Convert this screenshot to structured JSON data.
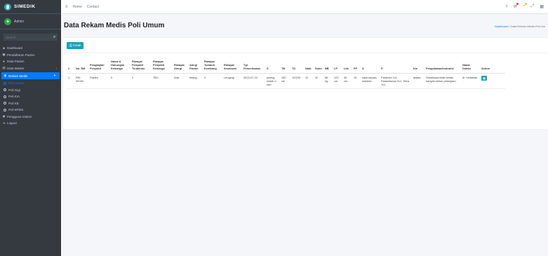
{
  "brand": {
    "name": "SIMEDIK"
  },
  "user": {
    "name": "Admin"
  },
  "search": {
    "placeholder": "Search"
  },
  "menu": [
    {
      "label": "Dashboard",
      "icon": "dashboard-icon"
    },
    {
      "label": "Pendaftaran Pasien",
      "icon": "register-icon"
    },
    {
      "label": "Data Pasien",
      "icon": "patients-icon"
    },
    {
      "label": "Data Master",
      "icon": "database-icon"
    },
    {
      "label": "Rekam Medik",
      "icon": "book-icon"
    },
    {
      "label": "Poli Umum"
    },
    {
      "label": "Poli Gigi"
    },
    {
      "label": "Poli KIA"
    },
    {
      "label": "Poli KB"
    },
    {
      "label": "Poli MTBS"
    },
    {
      "label": "Pengguna Sistem",
      "icon": "user-icon"
    },
    {
      "label": "Logout",
      "icon": "logout-icon"
    }
  ],
  "topbar": {
    "home": "Home",
    "contact": "Contact"
  },
  "page": {
    "title": "Data Rekam Medis Poli Umum",
    "breadcrumb_home": "Dashboard",
    "breadcrumb_current": "Data Rekam Medis Poli Um"
  },
  "buttons": {
    "print": "Cetak"
  },
  "table": {
    "headers": [
      "#",
      "No. RM",
      "Pengkajian Penyakit",
      "Nama & Hubungan Keluarga",
      "Riwayat Penyakit Terdahulu",
      "Riwayat Penyakit Keluarga",
      "Riwayat Alergi",
      "Alergi Pasien",
      "Riwayat Tumbuh Kembang",
      "Riwayat Imunisasi",
      "Tgl Pemeriksaan",
      "S",
      "TB",
      "TD",
      "Nadi",
      "Suhu",
      "BB",
      "LP",
      "Lila",
      "PF",
      "A",
      "P",
      "Kie",
      "Pengobatan/Instruksi",
      "Nama Dokter",
      "Action"
    ],
    "rows": [
      [
        "1.",
        "RM-00045",
        "Pasien",
        "0",
        "0",
        "TBC",
        "Ada",
        "bitang",
        "0",
        "Lengkap",
        "2023-07-24",
        "pusing sudah 2 hari",
        "160 cm",
        "120/30",
        "12",
        "32",
        "56 kg",
        "120 cm",
        "30 cm",
        "15",
        "sakit kepala sebelah",
        "Paramex 1x1, Paracetamol 3x1, Tetra 1x1",
        "asasa",
        "Sebaiknya tidak terlalu banyak beban pekerjaan",
        "dr. herlawan",
        ""
      ]
    ]
  },
  "colors": {
    "sidebar": "#343a40",
    "primary": "#007bff",
    "info": "#17a2b8"
  }
}
